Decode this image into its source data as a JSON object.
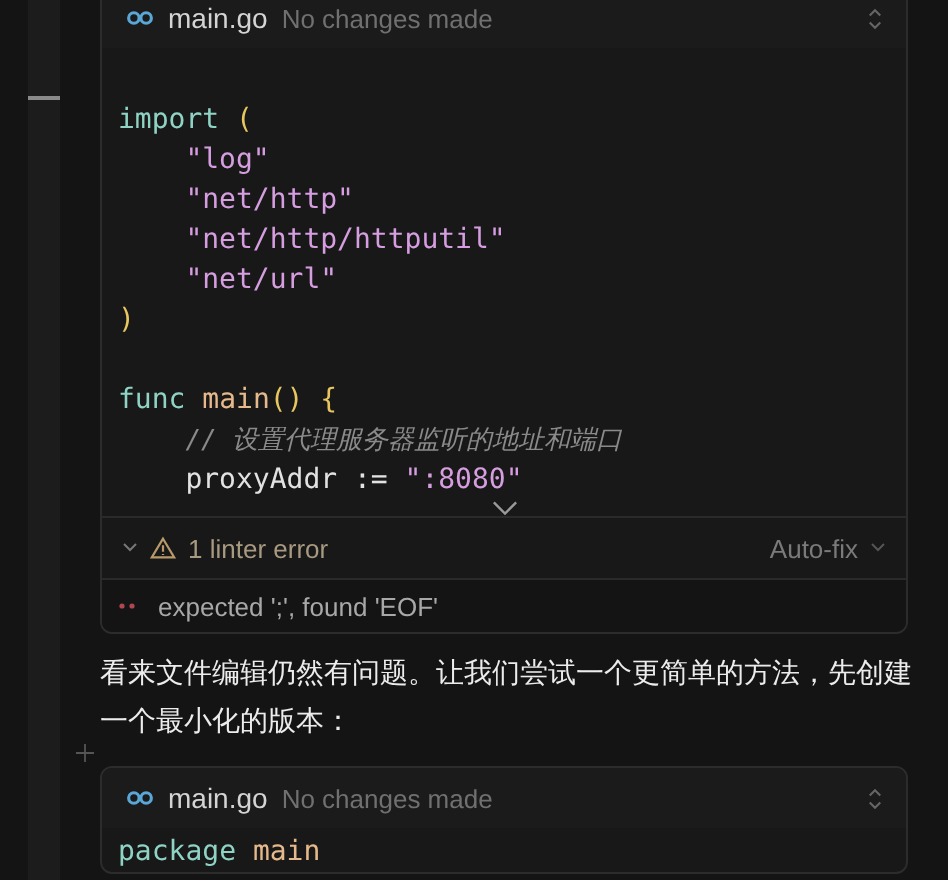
{
  "cards": [
    {
      "file": "main.go",
      "status": "No changes made",
      "code": [
        {
          "indented": false,
          "gap_before": true,
          "tokens": [
            {
              "kind": "keyword",
              "text": "import "
            },
            {
              "kind": "paren",
              "text": "("
            }
          ]
        },
        {
          "indented": true,
          "gap_before": false,
          "tokens": [
            {
              "kind": "string",
              "text": "\"log\""
            }
          ]
        },
        {
          "indented": true,
          "gap_before": false,
          "tokens": [
            {
              "kind": "string",
              "text": "\"net/http\""
            }
          ]
        },
        {
          "indented": true,
          "gap_before": false,
          "tokens": [
            {
              "kind": "string",
              "text": "\"net/http/httputil\""
            }
          ]
        },
        {
          "indented": true,
          "gap_before": false,
          "tokens": [
            {
              "kind": "string",
              "text": "\"net/url\""
            }
          ]
        },
        {
          "indented": false,
          "gap_before": false,
          "tokens": [
            {
              "kind": "paren",
              "text": ")"
            }
          ]
        },
        {
          "indented": false,
          "gap_before": true,
          "tokens": [
            {
              "kind": "keyword",
              "text": "func "
            },
            {
              "kind": "name",
              "text": "main"
            },
            {
              "kind": "paren",
              "text": "() {"
            }
          ]
        },
        {
          "indented": true,
          "gap_before": false,
          "tokens": [
            {
              "kind": "comment",
              "text": "// 设置代理服务器监听的地址和端口"
            }
          ]
        },
        {
          "indented": true,
          "gap_before": false,
          "tokens": [
            {
              "kind": "plain",
              "text": "proxyAddr := "
            },
            {
              "kind": "string",
              "text": "\":8080\""
            }
          ]
        }
      ],
      "expandable": true,
      "linter": {
        "summary": "1 linter error",
        "action": "Auto-fix",
        "expanded": true,
        "errors": [
          "expected ';', found 'EOF'"
        ]
      }
    },
    {
      "file": "main.go",
      "status": "No changes made",
      "code": [
        {
          "indented": false,
          "gap_before": false,
          "tokens": [
            {
              "kind": "keyword",
              "text": "package "
            },
            {
              "kind": "name",
              "text": "main"
            }
          ]
        }
      ],
      "expandable": false
    }
  ],
  "message": "看来文件编辑仍然有问题。让我们尝试一个更简单的方法，先创建一个最小化的版本："
}
